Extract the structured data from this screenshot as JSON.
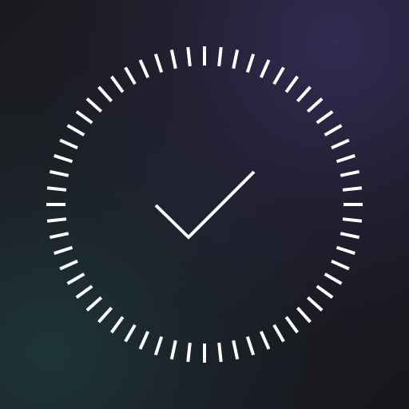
{
  "app_icon": {
    "name": "clock-check-app-icon",
    "tick_count": 60,
    "check_state": "checked"
  },
  "colors": {
    "background_base": "#18181c",
    "background_glow_top_right": "#443a7a",
    "background_glow_bottom_left": "#1e3e40",
    "foreground": "#ffffff"
  }
}
